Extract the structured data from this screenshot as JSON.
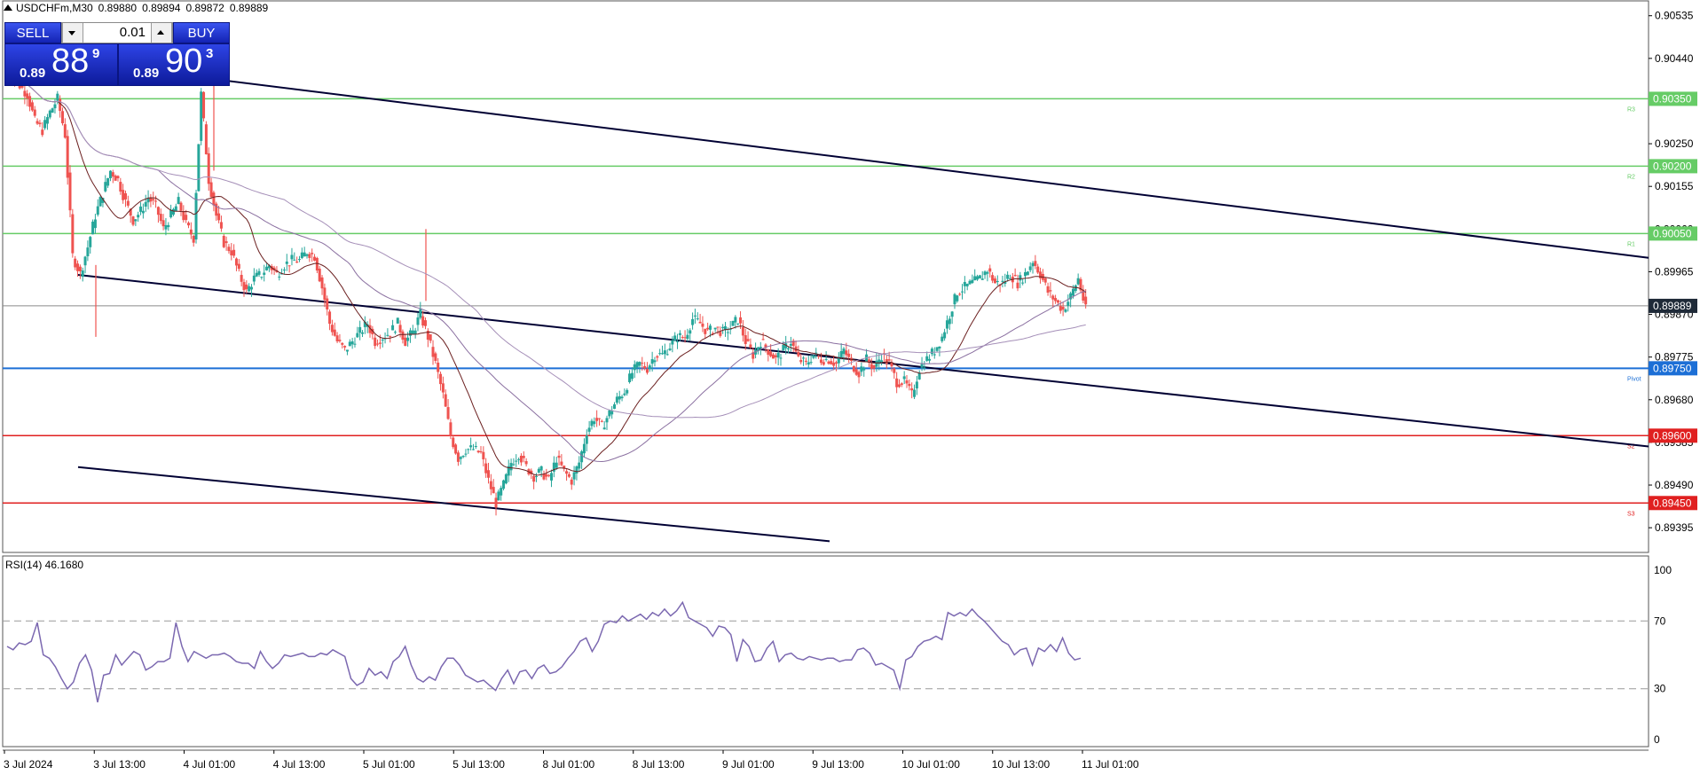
{
  "header": {
    "symbol": "USDCHFm,M30",
    "open": "0.89880",
    "high": "0.89894",
    "low": "0.89872",
    "close": "0.89889"
  },
  "trade_panel": {
    "sell_label": "SELL",
    "buy_label": "BUY",
    "lot_value": "0.01",
    "sell_prefix": "0.89",
    "sell_big": "88",
    "sell_sup": "9",
    "buy_prefix": "0.89",
    "buy_big": "90",
    "buy_sup": "3"
  },
  "colors": {
    "bull": "#26a69a",
    "bear": "#ef5350",
    "resistance": "#66cc66",
    "support": "#e02020",
    "pivot": "#1c6fd6",
    "trendline": "#000033",
    "rsi": "#7b68b0",
    "ma_fast": "#6b1f1f",
    "ma_slow": "#8a6fa0",
    "current_price_bg": "#1f2a38"
  },
  "price_axis": {
    "ticks": [
      "0.90535",
      "0.90440",
      "0.90250",
      "0.90155",
      "0.90060",
      "0.89965",
      "0.89870",
      "0.89775",
      "0.89680",
      "0.89585",
      "0.89490",
      "0.89395"
    ]
  },
  "levels": [
    {
      "label": "R3",
      "price_text": "0.90350",
      "price": 0.9035,
      "kind": "resistance"
    },
    {
      "label": "R2",
      "price_text": "0.90200",
      "price": 0.902,
      "kind": "resistance"
    },
    {
      "label": "R1",
      "price_text": "0.90050",
      "price": 0.9005,
      "kind": "resistance"
    },
    {
      "label": "Pivot",
      "price_text": "0.89750",
      "price": 0.8975,
      "kind": "pivot"
    },
    {
      "label": "S2",
      "price_text": "0.89600",
      "price": 0.896,
      "kind": "support"
    },
    {
      "label": "S3",
      "price_text": "0.89450",
      "price": 0.8945,
      "kind": "support"
    }
  ],
  "current_price": {
    "text": "0.89889",
    "value": 0.89889
  },
  "time_axis": {
    "labels": [
      "3 Jul 2024",
      "3 Jul 13:00",
      "4 Jul 01:00",
      "4 Jul 13:00",
      "5 Jul 01:00",
      "5 Jul 13:00",
      "8 Jul 01:00",
      "8 Jul 13:00",
      "9 Jul 01:00",
      "9 Jul 13:00",
      "10 Jul 01:00",
      "10 Jul 13:00",
      "11 Jul 01:00"
    ]
  },
  "rsi": {
    "label": "RSI(14) 46.1680",
    "levels_text": [
      "100",
      "70",
      "30",
      "0"
    ],
    "values": [
      55,
      53,
      57,
      56,
      58,
      69,
      50,
      48,
      43,
      36,
      30,
      34,
      45,
      50,
      41,
      22,
      38,
      39,
      50,
      44,
      48,
      52,
      50,
      41,
      43,
      46,
      46,
      48,
      69,
      55,
      46,
      52,
      50,
      48,
      50,
      50,
      51,
      49,
      46,
      45,
      45,
      42,
      52,
      46,
      42,
      45,
      50,
      49,
      50,
      51,
      49,
      49,
      51,
      50,
      53,
      51,
      49,
      36,
      32,
      34,
      42,
      38,
      40,
      36,
      46,
      49,
      55,
      44,
      36,
      34,
      37,
      35,
      43,
      48,
      48,
      44,
      38,
      36,
      34,
      35,
      32,
      29,
      36,
      41,
      33,
      40,
      41,
      36,
      42,
      44,
      39,
      40,
      43,
      48,
      52,
      58,
      60,
      52,
      58,
      68,
      70,
      69,
      73,
      70,
      72,
      74,
      71,
      75,
      73,
      77,
      73,
      76,
      81,
      72,
      70,
      68,
      66,
      61,
      67,
      66,
      62,
      46,
      59,
      55,
      46,
      47,
      54,
      58,
      46,
      50,
      51,
      48,
      47,
      49,
      48,
      47,
      48,
      48,
      46,
      47,
      47,
      53,
      54,
      51,
      44,
      45,
      43,
      41,
      30,
      47,
      49,
      55,
      58,
      59,
      61,
      59,
      75,
      73,
      75,
      73,
      77,
      73,
      70,
      66,
      62,
      58,
      56,
      50,
      53,
      54,
      44,
      54,
      52,
      56,
      52,
      60,
      51,
      47,
      48
    ]
  },
  "chart_data": {
    "type": "candlestick",
    "title": "USDCHFm,M30",
    "xlabel": "",
    "ylabel": "",
    "ylim": [
      0.8934,
      0.9057
    ],
    "x_labels": [
      "3 Jul 2024",
      "3 Jul 13:00",
      "4 Jul 01:00",
      "4 Jul 13:00",
      "5 Jul 01:00",
      "5 Jul 13:00",
      "8 Jul 01:00",
      "8 Jul 13:00",
      "9 Jul 01:00",
      "9 Jul 13:00",
      "10 Jul 01:00",
      "10 Jul 13:00",
      "11 Jul 01:00"
    ],
    "close_path": [
      0.904,
      0.9038,
      0.9036,
      0.903,
      0.9028,
      0.9032,
      0.9035,
      0.9027,
      0.9,
      0.8996,
      0.9002,
      0.9009,
      0.9014,
      0.9019,
      0.9017,
      0.9012,
      0.9008,
      0.901,
      0.9013,
      0.9011,
      0.9006,
      0.9009,
      0.9012,
      0.9007,
      0.9004,
      0.9036,
      0.9017,
      0.9009,
      0.9003,
      0.9001,
      0.8996,
      0.8992,
      0.8995,
      0.8996,
      0.8998,
      0.8996,
      0.8998,
      0.8999,
      0.8999,
      0.9001,
      0.9,
      0.8993,
      0.8985,
      0.8981,
      0.8979,
      0.8981,
      0.8983,
      0.8985,
      0.8981,
      0.8982,
      0.8983,
      0.8985,
      0.8981,
      0.8983,
      0.8987,
      0.8982,
      0.8976,
      0.8969,
      0.896,
      0.8955,
      0.8957,
      0.8957,
      0.8956,
      0.895,
      0.8945,
      0.8949,
      0.8954,
      0.8956,
      0.8953,
      0.8951,
      0.8952,
      0.895,
      0.8955,
      0.8952,
      0.895,
      0.8954,
      0.8961,
      0.8964,
      0.8962,
      0.8965,
      0.8968,
      0.897,
      0.8974,
      0.8976,
      0.8975,
      0.8978,
      0.8978,
      0.898,
      0.8982,
      0.8982,
      0.8986,
      0.8985,
      0.8983,
      0.8984,
      0.8983,
      0.8984,
      0.8986,
      0.8981,
      0.8978,
      0.8981,
      0.8979,
      0.8977,
      0.8979,
      0.8981,
      0.8977,
      0.8976,
      0.8978,
      0.8977,
      0.8977,
      0.8976,
      0.8979,
      0.8976,
      0.8974,
      0.8977,
      0.8975,
      0.8978,
      0.8976,
      0.8972,
      0.8972,
      0.8969,
      0.8975,
      0.8977,
      0.8979,
      0.8982,
      0.8987,
      0.8992,
      0.8993,
      0.8994,
      0.8995,
      0.8997,
      0.8994,
      0.8994,
      0.8996,
      0.8994,
      0.8996,
      0.8999,
      0.8996,
      0.8992,
      0.899,
      0.8988,
      0.8991,
      0.8995,
      0.8988
    ]
  }
}
